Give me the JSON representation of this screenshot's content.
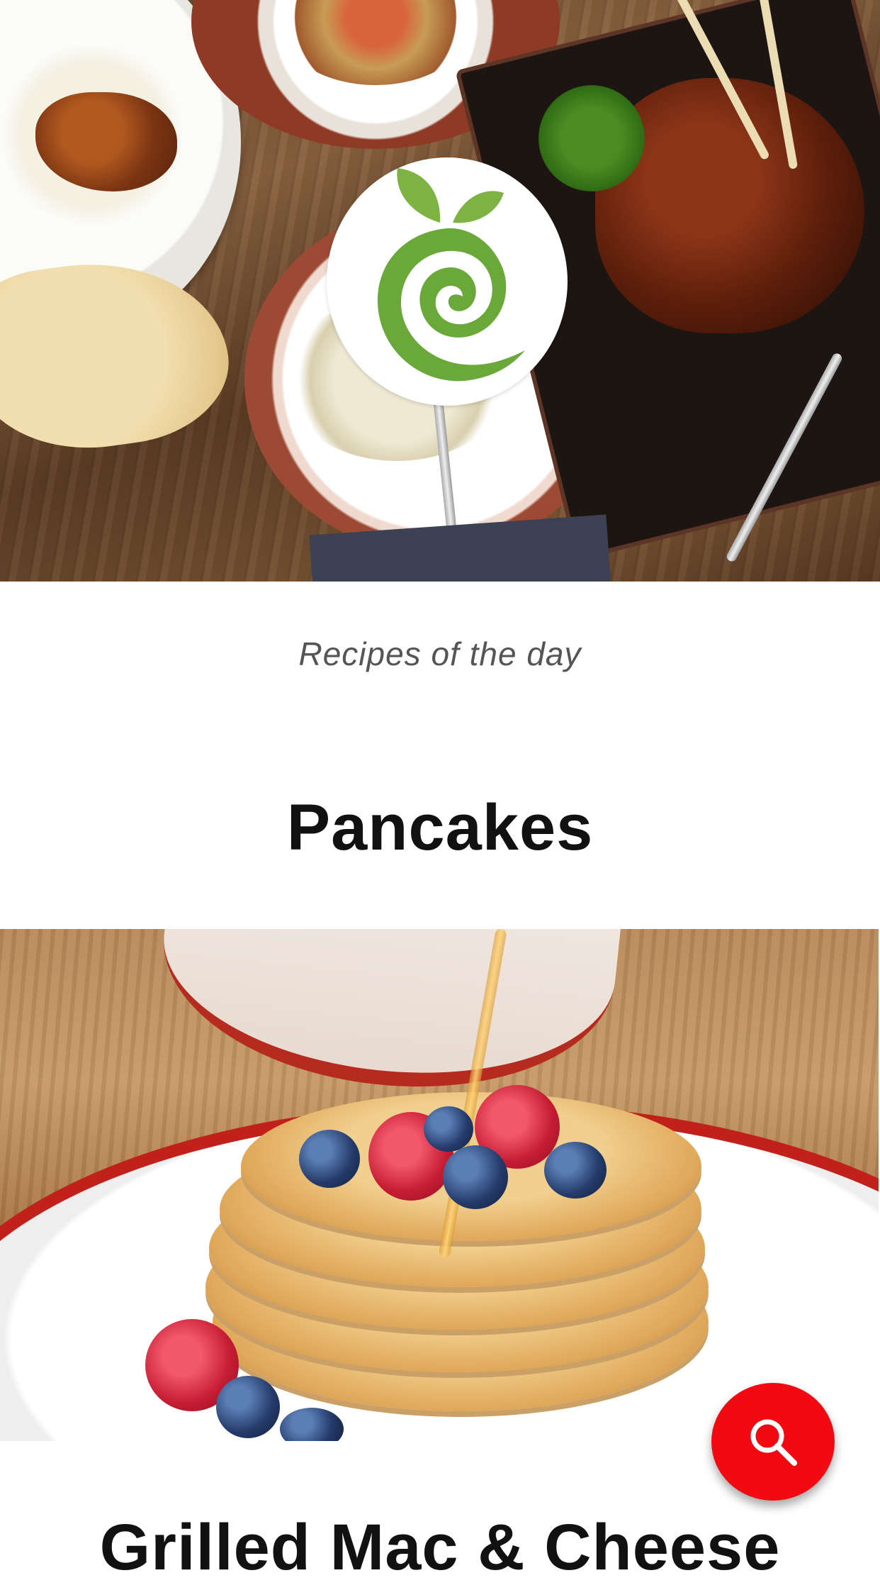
{
  "header": {
    "logo_icon": "leaf-spiral-logo-icon",
    "brand_colors": {
      "leaf": "#7cb342",
      "spiral": "#6aa83a"
    }
  },
  "section": {
    "subtitle": "Recipes of the day"
  },
  "recipes": [
    {
      "title": "Pancakes"
    },
    {
      "title": "Grilled Mac & Cheese"
    }
  ],
  "fab": {
    "icon": "search-icon",
    "color": "#f20a12"
  }
}
